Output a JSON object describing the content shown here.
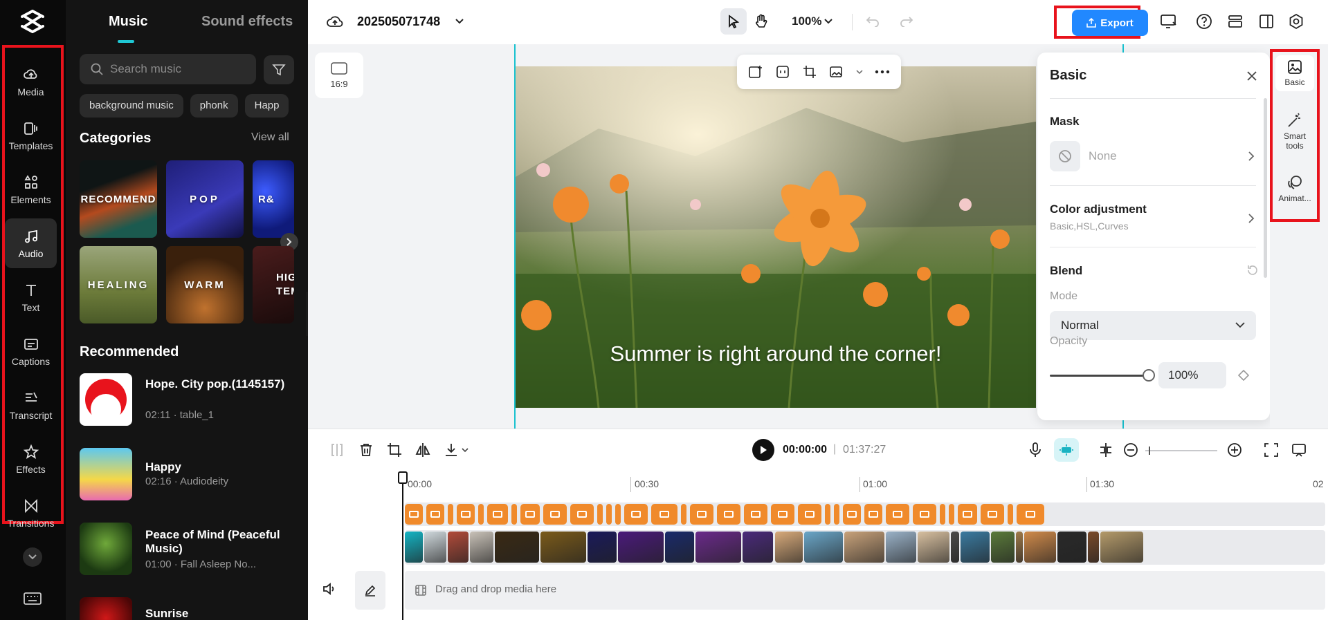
{
  "sidebar": {
    "items": [
      {
        "label": "Media",
        "icon": "cloud-upload-icon"
      },
      {
        "label": "Templates",
        "icon": "templates-icon"
      },
      {
        "label": "Elements",
        "icon": "elements-icon"
      },
      {
        "label": "Audio",
        "icon": "music-note-icon",
        "active": true
      },
      {
        "label": "Text",
        "icon": "text-icon"
      },
      {
        "label": "Captions",
        "icon": "captions-icon"
      },
      {
        "label": "Transcript",
        "icon": "transcript-icon"
      },
      {
        "label": "Effects",
        "icon": "effects-icon"
      },
      {
        "label": "Transitions",
        "icon": "transitions-icon"
      }
    ]
  },
  "music_panel": {
    "tabs": {
      "music": "Music",
      "sound_effects": "Sound effects"
    },
    "search_placeholder": "Search music",
    "chips": [
      "background music",
      "phonk",
      "Happ"
    ],
    "categories_title": "Categories",
    "view_all": "View all",
    "categories": [
      {
        "label": "RECOMMEND",
        "color": "#1c2a2a"
      },
      {
        "label": "POP",
        "color": "#2a2a8a"
      },
      {
        "label": "R&",
        "color": "#1a2aa0"
      },
      {
        "label": "HEALING",
        "color": "#6d7a3e"
      },
      {
        "label": "WARM",
        "color": "#5a3216"
      },
      {
        "label": "HIG TEM",
        "color": "#3a1414"
      }
    ],
    "recommended_title": "Recommended",
    "tracks": [
      {
        "title": "Hope. City pop.(1145157)",
        "meta": "02:11 · table_1"
      },
      {
        "title": "Happy",
        "meta": "02:16 · Audiodeity"
      },
      {
        "title": "Peace of Mind (Peaceful Music)",
        "meta": "01:00 · Fall Asleep No..."
      },
      {
        "title": "Sunrise",
        "meta": ""
      }
    ]
  },
  "topbar": {
    "project_name": "202505071748",
    "zoom": "100%",
    "export_label": "Export",
    "colors": {
      "accent": "#2188ff",
      "highlight": "#e8131c"
    }
  },
  "canvas": {
    "aspect_ratio": "16:9",
    "caption": "Summer is right around the corner!"
  },
  "properties": {
    "title": "Basic",
    "mask_label": "Mask",
    "mask_value": "None",
    "color_adjustment_label": "Color adjustment",
    "color_adjustment_sub": "Basic,HSL,Curves",
    "blend_label": "Blend",
    "mode_label": "Mode",
    "mode_value": "Normal",
    "opacity_label": "Opacity",
    "opacity_value": "100%",
    "opacity_level": 1.0
  },
  "right_rail": {
    "items": [
      {
        "label": "Basic",
        "icon": "image-icon"
      },
      {
        "label": "Smart tools",
        "icon": "magic-wand-icon"
      },
      {
        "label": "Animat...",
        "icon": "animation-icon"
      }
    ]
  },
  "timeline": {
    "current_time": "00:00:00",
    "separator": "|",
    "total_time": "01:37:27",
    "ruler": [
      "00:00",
      "00:30",
      "01:00",
      "01:30",
      "02"
    ],
    "drop_hint": "Drag and drop media here"
  }
}
